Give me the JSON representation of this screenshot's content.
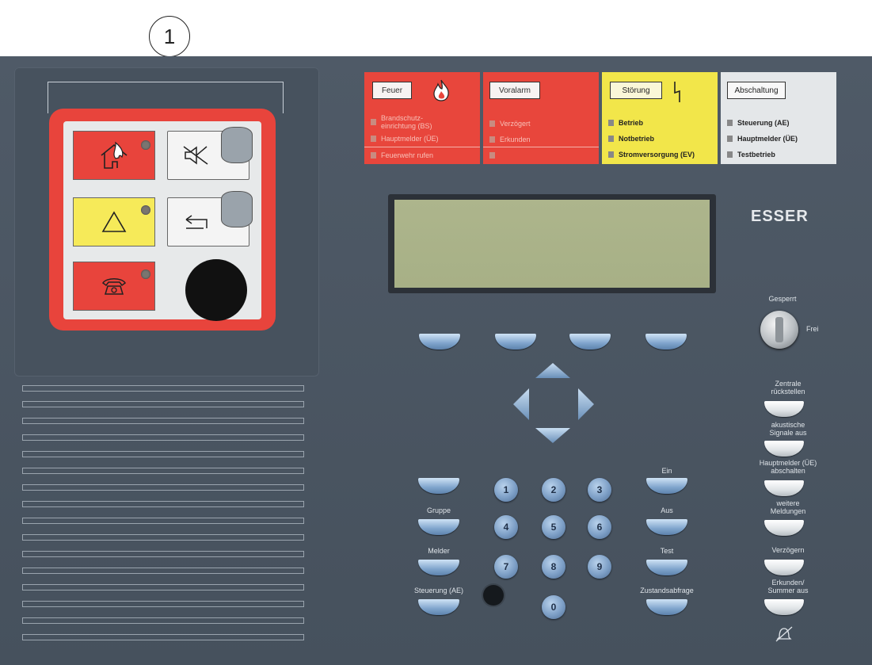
{
  "callout": {
    "number": "1"
  },
  "status_panel": {
    "feuer": {
      "label": "Feuer",
      "lines": [
        "Brandschutz-\neinrichtung (BS)",
        "Hauptmelder (ÜE)",
        "Feuerwehr rufen"
      ]
    },
    "voralarm": {
      "label": "Voralarm",
      "lines": [
        "Verzögert",
        "Erkunden",
        ""
      ]
    },
    "stoerung": {
      "label": "Störung",
      "lines": [
        "Betrieb",
        "Notbetrieb",
        "Stromversorgung (EV)"
      ]
    },
    "abschaltung": {
      "label": "Abschaltung",
      "lines": [
        "Steuerung (AE)",
        "Hauptmelder (ÜE)",
        "Testbetrieb"
      ]
    }
  },
  "brand": "ESSER",
  "key_switch": {
    "locked_label": "Gesperrt",
    "free_label": "Frei"
  },
  "left_keys": {
    "gruppe": "Gruppe",
    "melder": "Melder",
    "steuerung": "Steuerung (AE)"
  },
  "numpad": [
    "1",
    "2",
    "3",
    "4",
    "5",
    "6",
    "7",
    "8",
    "9",
    "0"
  ],
  "mid_keys": {
    "ein": "Ein",
    "aus": "Aus",
    "test": "Test",
    "zustand": "Zustandsabfrage"
  },
  "right_keys": {
    "reset": "Zentrale\nrückstellen",
    "acoustic": "akustische\nSignale aus",
    "hauptmelder": "Hauptmelder (ÜE)\nabschalten",
    "weitere": "weitere\nMeldungen",
    "verzoegern": "Verzögern",
    "erkunden": "Erkunden/\nSummer aus"
  },
  "icons": {
    "fire": "fire-house-icon",
    "warning": "triangle-icon",
    "phone": "telephone-icon",
    "mute": "speaker-mute-icon",
    "return": "return-arrow-icon",
    "bell": "bell-icon"
  },
  "colors": {
    "panel": "#4a5562",
    "red": "#e8443c",
    "yellow": "#f6ea59",
    "key_blue": "#7fa4cc"
  }
}
